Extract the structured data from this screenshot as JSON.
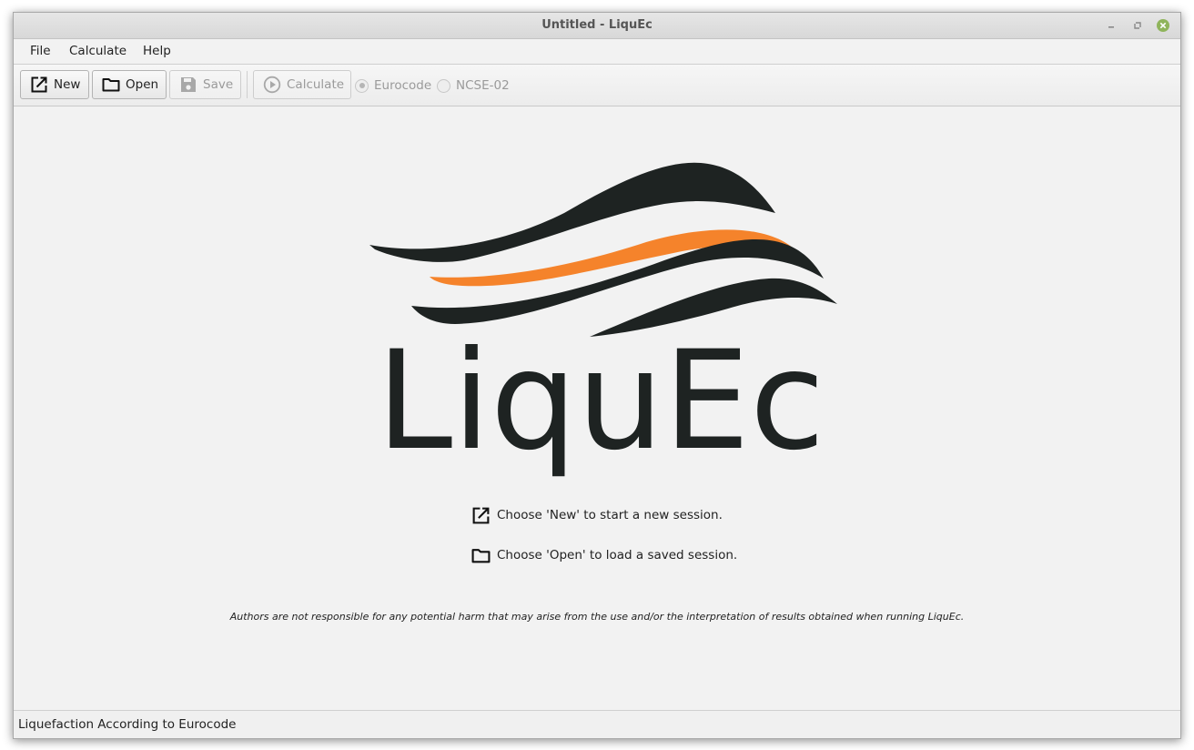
{
  "window": {
    "title": "Untitled - LiquEc"
  },
  "menu": [
    "File",
    "Calculate",
    "Help"
  ],
  "toolbar": {
    "new_label": "New",
    "open_label": "Open",
    "save_label": "Save",
    "calculate_label": "Calculate",
    "radio_eurocode": "Eurocode",
    "radio_ncse": "NCSE-02",
    "selected_code": "Eurocode"
  },
  "logo": {
    "text": "LiquEc",
    "colors": {
      "dark": "#1e2322",
      "accent": "#f5832b"
    }
  },
  "welcome": {
    "new_hint": "Choose 'New' to start a new session.",
    "open_hint": "Choose 'Open' to load a saved session.",
    "disclaimer": "Authors are not responsible for any potential harm that may arise from the use and/or the interpretation of results obtained when running LiquEc."
  },
  "status": {
    "text": "Liquefaction According to Eurocode"
  },
  "icons": {
    "new": "new-session-icon",
    "open": "folder-icon",
    "save": "floppy-disk-icon",
    "calculate": "play-circle-icon",
    "window_close": "close-icon"
  },
  "colors": {
    "window_bg": "#f2f2f2",
    "close_button": "#8fb45b"
  }
}
